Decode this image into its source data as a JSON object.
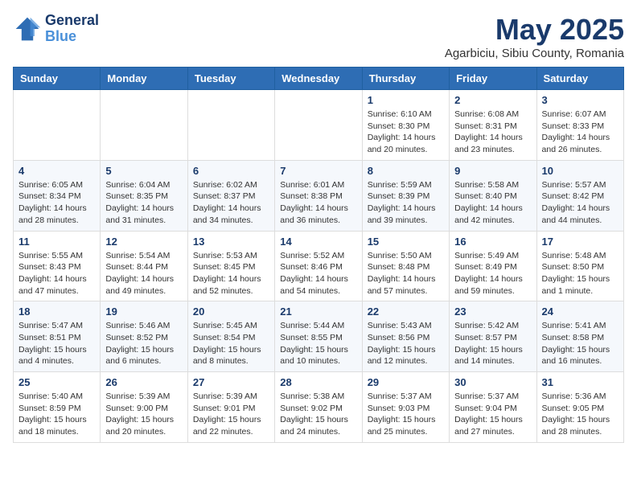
{
  "header": {
    "logo_line1": "General",
    "logo_line2": "Blue",
    "month_title": "May 2025",
    "location": "Agarbiciu, Sibiu County, Romania"
  },
  "weekdays": [
    "Sunday",
    "Monday",
    "Tuesday",
    "Wednesday",
    "Thursday",
    "Friday",
    "Saturday"
  ],
  "weeks": [
    [
      {
        "day": "",
        "info": ""
      },
      {
        "day": "",
        "info": ""
      },
      {
        "day": "",
        "info": ""
      },
      {
        "day": "",
        "info": ""
      },
      {
        "day": "1",
        "info": "Sunrise: 6:10 AM\nSunset: 8:30 PM\nDaylight: 14 hours and 20 minutes."
      },
      {
        "day": "2",
        "info": "Sunrise: 6:08 AM\nSunset: 8:31 PM\nDaylight: 14 hours and 23 minutes."
      },
      {
        "day": "3",
        "info": "Sunrise: 6:07 AM\nSunset: 8:33 PM\nDaylight: 14 hours and 26 minutes."
      }
    ],
    [
      {
        "day": "4",
        "info": "Sunrise: 6:05 AM\nSunset: 8:34 PM\nDaylight: 14 hours and 28 minutes."
      },
      {
        "day": "5",
        "info": "Sunrise: 6:04 AM\nSunset: 8:35 PM\nDaylight: 14 hours and 31 minutes."
      },
      {
        "day": "6",
        "info": "Sunrise: 6:02 AM\nSunset: 8:37 PM\nDaylight: 14 hours and 34 minutes."
      },
      {
        "day": "7",
        "info": "Sunrise: 6:01 AM\nSunset: 8:38 PM\nDaylight: 14 hours and 36 minutes."
      },
      {
        "day": "8",
        "info": "Sunrise: 5:59 AM\nSunset: 8:39 PM\nDaylight: 14 hours and 39 minutes."
      },
      {
        "day": "9",
        "info": "Sunrise: 5:58 AM\nSunset: 8:40 PM\nDaylight: 14 hours and 42 minutes."
      },
      {
        "day": "10",
        "info": "Sunrise: 5:57 AM\nSunset: 8:42 PM\nDaylight: 14 hours and 44 minutes."
      }
    ],
    [
      {
        "day": "11",
        "info": "Sunrise: 5:55 AM\nSunset: 8:43 PM\nDaylight: 14 hours and 47 minutes."
      },
      {
        "day": "12",
        "info": "Sunrise: 5:54 AM\nSunset: 8:44 PM\nDaylight: 14 hours and 49 minutes."
      },
      {
        "day": "13",
        "info": "Sunrise: 5:53 AM\nSunset: 8:45 PM\nDaylight: 14 hours and 52 minutes."
      },
      {
        "day": "14",
        "info": "Sunrise: 5:52 AM\nSunset: 8:46 PM\nDaylight: 14 hours and 54 minutes."
      },
      {
        "day": "15",
        "info": "Sunrise: 5:50 AM\nSunset: 8:48 PM\nDaylight: 14 hours and 57 minutes."
      },
      {
        "day": "16",
        "info": "Sunrise: 5:49 AM\nSunset: 8:49 PM\nDaylight: 14 hours and 59 minutes."
      },
      {
        "day": "17",
        "info": "Sunrise: 5:48 AM\nSunset: 8:50 PM\nDaylight: 15 hours and 1 minute."
      }
    ],
    [
      {
        "day": "18",
        "info": "Sunrise: 5:47 AM\nSunset: 8:51 PM\nDaylight: 15 hours and 4 minutes."
      },
      {
        "day": "19",
        "info": "Sunrise: 5:46 AM\nSunset: 8:52 PM\nDaylight: 15 hours and 6 minutes."
      },
      {
        "day": "20",
        "info": "Sunrise: 5:45 AM\nSunset: 8:54 PM\nDaylight: 15 hours and 8 minutes."
      },
      {
        "day": "21",
        "info": "Sunrise: 5:44 AM\nSunset: 8:55 PM\nDaylight: 15 hours and 10 minutes."
      },
      {
        "day": "22",
        "info": "Sunrise: 5:43 AM\nSunset: 8:56 PM\nDaylight: 15 hours and 12 minutes."
      },
      {
        "day": "23",
        "info": "Sunrise: 5:42 AM\nSunset: 8:57 PM\nDaylight: 15 hours and 14 minutes."
      },
      {
        "day": "24",
        "info": "Sunrise: 5:41 AM\nSunset: 8:58 PM\nDaylight: 15 hours and 16 minutes."
      }
    ],
    [
      {
        "day": "25",
        "info": "Sunrise: 5:40 AM\nSunset: 8:59 PM\nDaylight: 15 hours and 18 minutes."
      },
      {
        "day": "26",
        "info": "Sunrise: 5:39 AM\nSunset: 9:00 PM\nDaylight: 15 hours and 20 minutes."
      },
      {
        "day": "27",
        "info": "Sunrise: 5:39 AM\nSunset: 9:01 PM\nDaylight: 15 hours and 22 minutes."
      },
      {
        "day": "28",
        "info": "Sunrise: 5:38 AM\nSunset: 9:02 PM\nDaylight: 15 hours and 24 minutes."
      },
      {
        "day": "29",
        "info": "Sunrise: 5:37 AM\nSunset: 9:03 PM\nDaylight: 15 hours and 25 minutes."
      },
      {
        "day": "30",
        "info": "Sunrise: 5:37 AM\nSunset: 9:04 PM\nDaylight: 15 hours and 27 minutes."
      },
      {
        "day": "31",
        "info": "Sunrise: 5:36 AM\nSunset: 9:05 PM\nDaylight: 15 hours and 28 minutes."
      }
    ]
  ]
}
